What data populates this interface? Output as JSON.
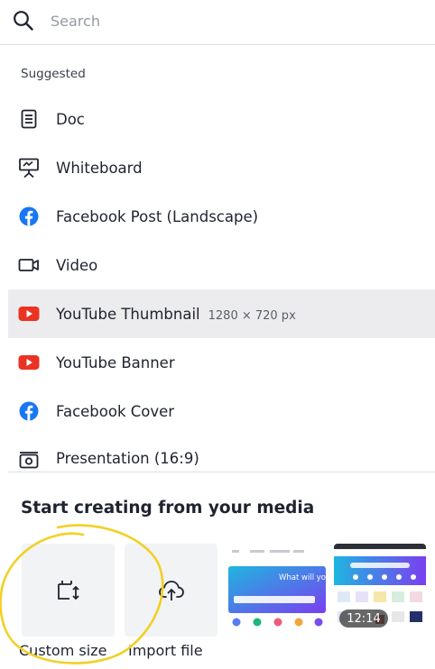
{
  "search": {
    "placeholder": "Search",
    "value": ""
  },
  "suggested": {
    "label": "Suggested",
    "items": [
      {
        "icon": "document-icon",
        "label": "Doc",
        "sub": ""
      },
      {
        "icon": "whiteboard-icon",
        "label": "Whiteboard",
        "sub": ""
      },
      {
        "icon": "facebook-icon",
        "label": "Facebook Post (Landscape)",
        "sub": ""
      },
      {
        "icon": "video-camera-icon",
        "label": "Video",
        "sub": ""
      },
      {
        "icon": "youtube-icon",
        "label": "YouTube Thumbnail",
        "sub": "1280 × 720 px"
      },
      {
        "icon": "youtube-icon",
        "label": "YouTube Banner",
        "sub": ""
      },
      {
        "icon": "facebook-icon",
        "label": "Facebook Cover",
        "sub": ""
      },
      {
        "icon": "presentation-icon",
        "label": "Presentation (16:9)",
        "sub": ""
      }
    ]
  },
  "media": {
    "title": "Start creating from your media",
    "cards": [
      {
        "icon": "custom-size-icon",
        "label": "Custom size"
      },
      {
        "icon": "cloud-upload-icon",
        "label": "Import file"
      }
    ],
    "thumbnails": [
      {
        "heading": "What will you design today?",
        "duration": ""
      },
      {
        "heading": "",
        "duration": "12:14"
      }
    ]
  },
  "colors": {
    "facebook": "#1877f2",
    "youtube": "#ea3323",
    "active_row": "#ececee",
    "annotation": "#f2d024",
    "brand_gradient_start": "#1fb5e0",
    "brand_gradient_end": "#7a3ff0"
  }
}
